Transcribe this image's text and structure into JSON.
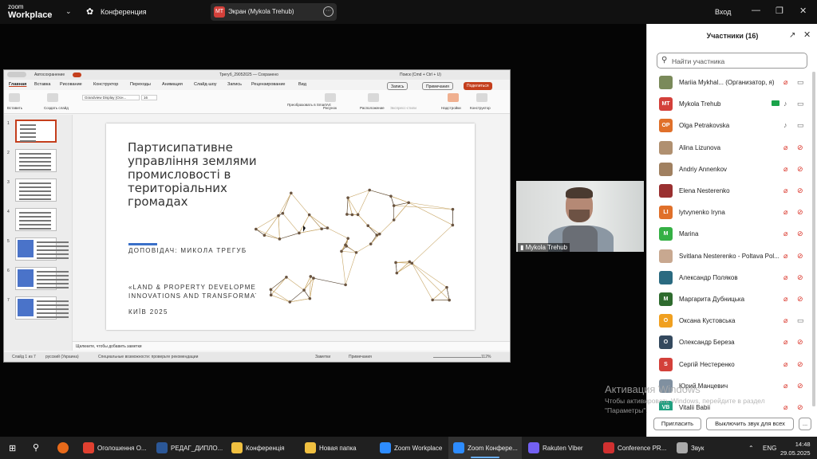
{
  "topbar": {
    "app_name_line1": "zoom",
    "app_name_line2": "Workplace",
    "meeting_label": "Конференция",
    "share_pill_avatar": "MT",
    "share_pill_text": "Экран (Mykola Trehub)",
    "signin_label": "Вход"
  },
  "ppt": {
    "autosave": "Автосохранение",
    "doc_title": "Трегуб_29052025 — Сохранено",
    "search": "Поиск (Cmd + Ctrl + U)",
    "menu": [
      "Главная",
      "Вставка",
      "Рисование",
      "Конструктор",
      "Переходы",
      "Анимация",
      "Слайд-шоу",
      "Запись",
      "Рецензирование",
      "Вид"
    ],
    "record_btn": "Запись",
    "notes_btn": "Примечания",
    "share_btn": "Поделиться",
    "ribbon_labels": [
      "Вставить",
      "Создать слайд",
      "Рисунок",
      "Расположение",
      "Экспресс-стили",
      "Надстройки",
      "Конструктор"
    ],
    "font_name": "Grandview Display (Осн...",
    "font_size": "16",
    "smartart_label": "Преобразовать в SmartArt",
    "slide_count": 7,
    "slide": {
      "title": "Партисипативне управління землями промисловості в територіальних громадах",
      "speaker": "ДОПОВІДАЧ: МИКОЛА ТРЕГУБ",
      "line1": "«LAND & PROPERTY DEVELOPMENT",
      "line2": "INNOVATIONS AND TRANSFORMATI",
      "city": "КИЇВ 2025"
    },
    "notes_placeholder": "Щелкните, чтобы добавить заметки",
    "status_slide": "Слайд 1 из 7",
    "status_lang": "русский (Украина)",
    "status_access": "Специальные возможности: проверьте рекомендации",
    "status_notes": "Заметки",
    "status_comments": "Примечания",
    "zoom": "112%"
  },
  "video": {
    "name": "Mykola Trehub"
  },
  "participants": {
    "title": "Участники (16)",
    "search_placeholder": "Найти участника",
    "list": [
      {
        "name": "Mariia Mykhal...  (Организатор, я)",
        "initials": "",
        "color": "#7a8a5a",
        "mic": "off",
        "cam": "on"
      },
      {
        "name": "Mykola Trehub",
        "initials": "MT",
        "color": "#d3403a",
        "mic": "on",
        "cam": "on",
        "sharing": true
      },
      {
        "name": "Olga Petrakovska",
        "initials": "OP",
        "color": "#e0702a",
        "mic": "on",
        "cam": "on"
      },
      {
        "name": "Alina Lizunova",
        "initials": "",
        "color": "#b09070",
        "mic": "off",
        "cam": "off"
      },
      {
        "name": "Andriy Annenkov",
        "initials": "",
        "color": "#a08060",
        "mic": "off",
        "cam": "off"
      },
      {
        "name": "Elena Nesterenko",
        "initials": "",
        "color": "#9a3030",
        "mic": "off",
        "cam": "off"
      },
      {
        "name": "lytvynenko Iryna",
        "initials": "LI",
        "color": "#e0702a",
        "mic": "off",
        "cam": "off"
      },
      {
        "name": "Marina",
        "initials": "M",
        "color": "#35b045",
        "mic": "off",
        "cam": "off"
      },
      {
        "name": "Svitlana Nesterenko - Poltava Pol...",
        "initials": "",
        "color": "#c8a890",
        "mic": "off",
        "cam": "off"
      },
      {
        "name": "Александр Поляков",
        "initials": "",
        "color": "#2a6a80",
        "mic": "off",
        "cam": "off"
      },
      {
        "name": "Маргарита Дубницька",
        "initials": "M",
        "color": "#2e6b2e",
        "mic": "off",
        "cam": "off"
      },
      {
        "name": "Оксана Кустовська",
        "initials": "O",
        "color": "#f0a020",
        "mic": "off",
        "cam": "on"
      },
      {
        "name": "Олександр Береза",
        "initials": "O",
        "color": "#34495e",
        "mic": "off",
        "cam": "off"
      },
      {
        "name": "Сергій Нестеренко",
        "initials": "S",
        "color": "#d3403a",
        "mic": "off",
        "cam": "off"
      },
      {
        "name": "Юрий Манцевич",
        "initials": "",
        "color": "#8090a0",
        "mic": "off",
        "cam": "off"
      },
      {
        "name": "Vitalii Babii",
        "initials": "VB",
        "color": "#20a080",
        "mic": "off",
        "cam": "off"
      }
    ],
    "invite_btn": "Пригласить",
    "mute_all_btn": "Выключить звук для всех",
    "more_btn": "..."
  },
  "watermark": {
    "line1": "Активация Windows",
    "line2": "Чтобы активировать Windows, перейдите в раздел",
    "line3": "\"Параметры\"."
  },
  "taskbar": {
    "items": [
      {
        "label": "Оголошення О...",
        "color": "#e04030"
      },
      {
        "label": "РЕДАГ_ДИПЛО...",
        "color": "#2b5797"
      },
      {
        "label": "Конференція",
        "color": "#f0c040"
      },
      {
        "label": "Новая папка",
        "color": "#f0c040"
      },
      {
        "label": "Zoom Workplace",
        "color": "#2d8cff"
      },
      {
        "label": "Zoom Конфере...",
        "color": "#2d8cff"
      },
      {
        "label": "Rakuten Viber",
        "color": "#7360f2"
      },
      {
        "label": "Conference PR...",
        "color": "#d03030"
      },
      {
        "label": "Звук",
        "color": "#aaaaaa"
      }
    ],
    "lang": "ENG",
    "time": "14:48",
    "date": "29.05.2025"
  }
}
